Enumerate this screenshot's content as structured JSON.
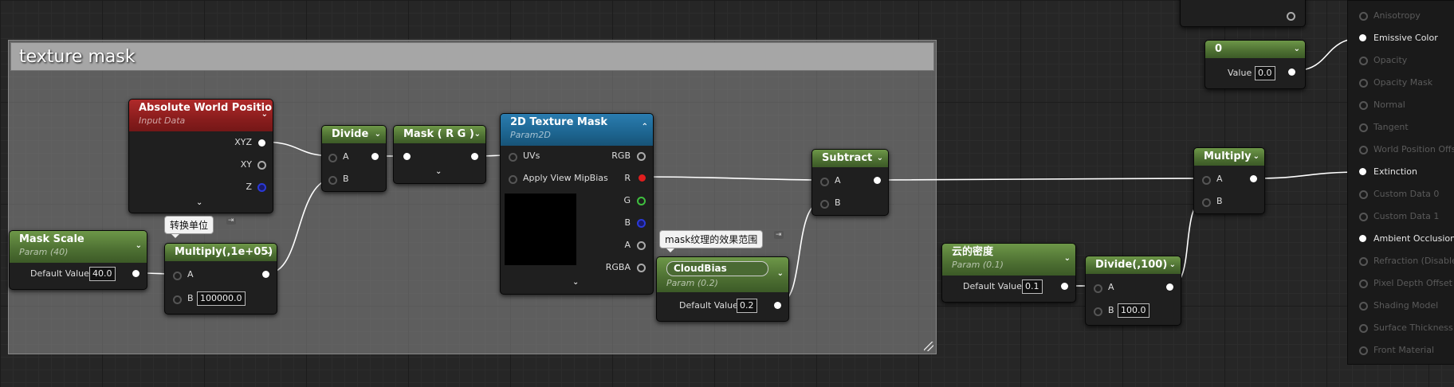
{
  "comment": {
    "title": "texture mask"
  },
  "nodes": {
    "absolute_world_position": {
      "title": "Absolute World Position",
      "subtitle": "Input Data",
      "pins": [
        "XYZ",
        "XY",
        "Z"
      ]
    },
    "mask_scale": {
      "title": "Mask Scale",
      "subtitle": "Param (40)",
      "field_label": "Default Value",
      "field_value": "40.0"
    },
    "multiply_1e5": {
      "title": "Multiply(,1e+05)",
      "pin_a": "A",
      "pin_b": "B",
      "b_value": "100000.0",
      "comment": "转换单位"
    },
    "divide": {
      "title": "Divide",
      "pin_a": "A",
      "pin_b": "B"
    },
    "mask_rg": {
      "title": "Mask ( R G )"
    },
    "texture_mask": {
      "title": "2D Texture Mask",
      "subtitle": "Param2D",
      "inputs": [
        "UVs",
        "Apply View MipBias"
      ],
      "outputs": [
        "RGB",
        "R",
        "G",
        "B",
        "A",
        "RGBA"
      ]
    },
    "cloud_bias": {
      "title": "CloudBias",
      "subtitle": "Param (0.2)",
      "field_label": "Default Value",
      "field_value": "0.2",
      "comment": "mask纹理的效果范围"
    },
    "subtract": {
      "title": "Subtract",
      "pin_a": "A",
      "pin_b": "B"
    },
    "cloud_density": {
      "title": "云的密度",
      "subtitle": "Param (0.1)",
      "field_label": "Default Value",
      "field_value": "0.1"
    },
    "divide_100": {
      "title": "Divide(,100)",
      "pin_a": "A",
      "pin_b": "B",
      "b_value": "100.0"
    },
    "multiply": {
      "title": "Multiply",
      "pin_a": "A",
      "pin_b": "B"
    },
    "constant_zero": {
      "title": "0",
      "field_label": "Value",
      "field_value": "0.0"
    }
  },
  "result_pins": {
    "items": [
      {
        "label": "Anisotropy",
        "active": false
      },
      {
        "label": "Emissive Color",
        "active": true
      },
      {
        "label": "Opacity",
        "active": false
      },
      {
        "label": "Opacity Mask",
        "active": false
      },
      {
        "label": "Normal",
        "active": false
      },
      {
        "label": "Tangent",
        "active": false
      },
      {
        "label": "World Position Offset",
        "active": false
      },
      {
        "label": "Extinction",
        "active": true
      },
      {
        "label": "Custom Data 0",
        "active": false
      },
      {
        "label": "Custom Data 1",
        "active": false
      },
      {
        "label": "Ambient Occlusion",
        "active": true
      },
      {
        "label": "Refraction (Disabled)",
        "active": false
      },
      {
        "label": "Pixel Depth Offset",
        "active": false
      },
      {
        "label": "Shading Model",
        "active": false
      },
      {
        "label": "Surface Thickness",
        "active": false
      },
      {
        "label": "Front Material",
        "active": false
      }
    ]
  },
  "colors": {
    "param_header": "#5a8040",
    "input_header": "#9a2424",
    "texture_header": "#2370a0",
    "wire": "#ffffff"
  }
}
